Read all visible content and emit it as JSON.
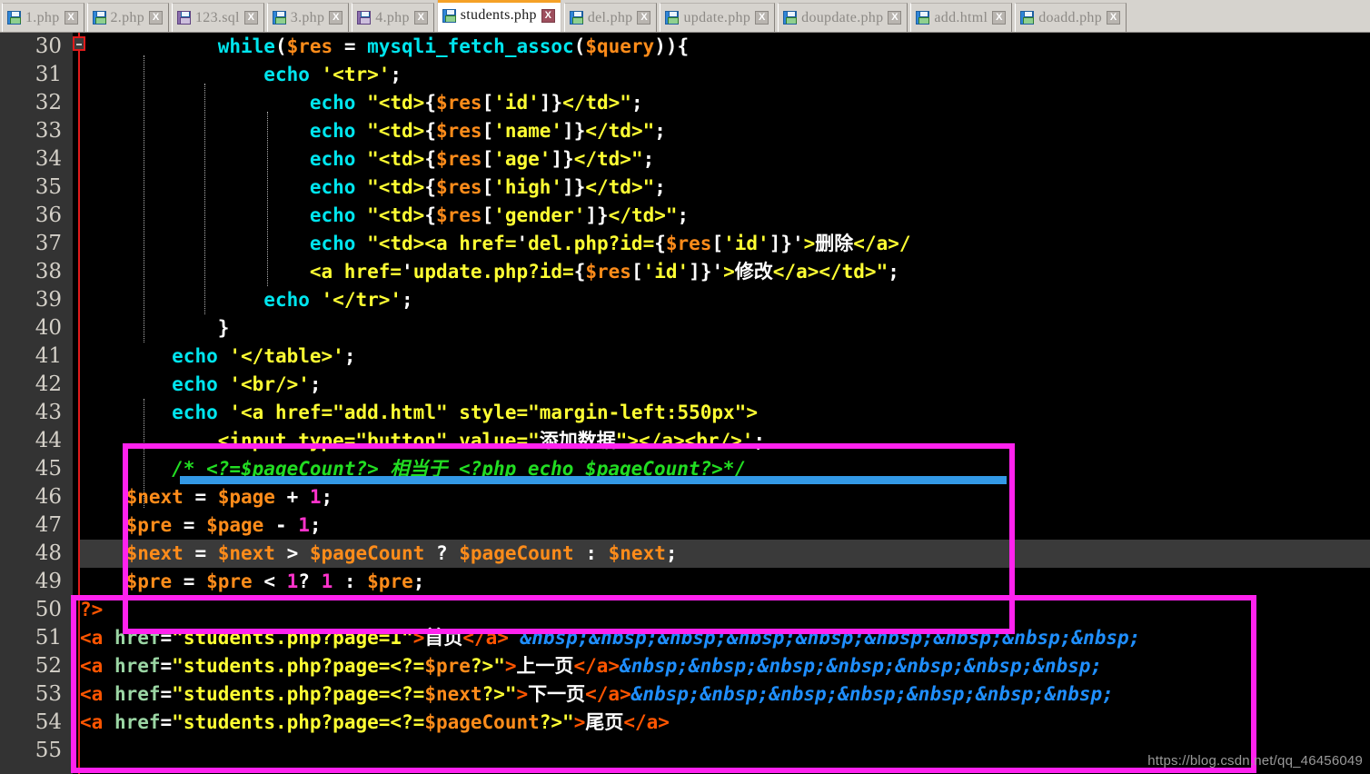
{
  "window": {
    "active_file": "students.php"
  },
  "tabs": [
    {
      "label": "1.php",
      "icon": "floppy-disk-icon",
      "close": "X",
      "active": false,
      "icon_color": "#2f86d8"
    },
    {
      "label": "2.php",
      "icon": "floppy-disk-icon",
      "close": "X",
      "active": false,
      "icon_color": "#2f86d8"
    },
    {
      "label": "123.sql",
      "icon": "floppy-disk-icon",
      "close": "X",
      "active": false,
      "icon_color": "#8b6fae"
    },
    {
      "label": "3.php",
      "icon": "floppy-disk-icon",
      "close": "X",
      "active": false,
      "icon_color": "#2f86d8"
    },
    {
      "label": "4.php",
      "icon": "floppy-disk-icon",
      "close": "X",
      "active": false,
      "icon_color": "#8b6fae"
    },
    {
      "label": "students.php",
      "icon": "floppy-disk-icon",
      "close": "X",
      "active": true,
      "icon_color": "#2f86d8"
    },
    {
      "label": "del.php",
      "icon": "floppy-disk-icon",
      "close": "X",
      "active": false,
      "icon_color": "#2f86d8"
    },
    {
      "label": "update.php",
      "icon": "floppy-disk-icon",
      "close": "X",
      "active": false,
      "icon_color": "#2f86d8"
    },
    {
      "label": "doupdate.php",
      "icon": "floppy-disk-icon",
      "close": "X",
      "active": false,
      "icon_color": "#2f86d8"
    },
    {
      "label": "add.html",
      "icon": "floppy-disk-icon",
      "close": "X",
      "active": false,
      "icon_color": "#2f86d8"
    },
    {
      "label": "doadd.php",
      "icon": "floppy-disk-icon",
      "close": "X",
      "active": false,
      "icon_color": "#2f86d8"
    }
  ],
  "editor": {
    "first_line": 30,
    "last_line": 55,
    "current_line": 48,
    "line_numbers": [
      30,
      31,
      32,
      33,
      34,
      35,
      36,
      37,
      38,
      39,
      40,
      41,
      42,
      43,
      44,
      45,
      46,
      47,
      48,
      49,
      50,
      51,
      52,
      53,
      54,
      55
    ],
    "lines": {
      "30": "            while($res = mysqli_fetch_assoc($query)){",
      "31": "                echo '<tr>';",
      "32": "                    echo \"<td>{$res['id']}</td>\";",
      "33": "                    echo \"<td>{$res['name']}</td>\";",
      "34": "                    echo \"<td>{$res['age']}</td>\";",
      "35": "                    echo \"<td>{$res['high']}</td>\";",
      "36": "                    echo \"<td>{$res['gender']}</td>\";",
      "37": "                    echo \"<td><a href='del.php?id={$res['id']}'>删除</a>/",
      "38": "                    <a href='update.php?id={$res['id']}'>修改</a></td>\";",
      "39": "                echo '</tr>';",
      "40": "            }",
      "41": "        echo '</table>';",
      "42": "        echo '<br/>';",
      "43": "        echo '<a href=\"add.html\" style=\"margin-left:550px\">",
      "44": "            <input type=\"button\" value=\"添加数据\"></a><br/>';",
      "45": "        /* <?=$pageCount?> 相当于 <?php echo $pageCount?>*/",
      "46": "    $next = $page + 1;",
      "47": "    $pre = $page - 1;",
      "48": "    $next = $next > $pageCount ? $pageCount : $next;",
      "49": "    $pre = $pre < 1? 1 : $pre;",
      "50": "?>",
      "51": "<a href=\"students.php?page=1\">首页</a> &nbsp;&nbsp;&nbsp;&nbsp;&nbsp;&nbsp;&nbsp;&nb",
      "52": "<a href=\"students.php?page=<?=$pre?>\">上一页</a>&nbsp;&nbsp;&nbsp;&nbsp;&nbsp;&nbsp",
      "53": "<a href=\"students.php?page=<?=$next?>\">下一页</a>&nbsp;&nbsp;&nbsp;&nbsp;&nbsp;&nbsp",
      "54": "<a href=\"students.php?page=<?=$pageCount?>\">尾页</a>",
      "55": ""
    },
    "tokens": {
      "kw_while": "while",
      "kw_echo": "echo",
      "fn_fetch": "mysqli_fetch_assoc",
      "var_res": "$res",
      "var_query": "$query",
      "var_next": "$next",
      "var_pre": "$pre",
      "var_page": "$page",
      "var_pagecount": "$pageCount",
      "comment_45": "/* <?=$pageCount?> 相当于 <?php echo $pageCount?>*/",
      "php_close": "?>",
      "entity": "&nbsp;",
      "cjk_delete": "删除",
      "cjk_modify": "修改",
      "cjk_add_data": "添加数据",
      "cjk_first_page": "首页",
      "cjk_prev_page": "上一页",
      "cjk_next_page": "下一页",
      "cjk_last_page": "尾页",
      "cjk_equivalent": "相当于"
    }
  },
  "annotations": {
    "box_top_name": "pagination-variable-block-highlight",
    "box_bottom_name": "pagination-links-block-highlight",
    "box_color": "#ff22ee",
    "underline_color": "#3399e6"
  },
  "watermark": {
    "text": "https://blog.csdn.net/qq_46456049"
  }
}
